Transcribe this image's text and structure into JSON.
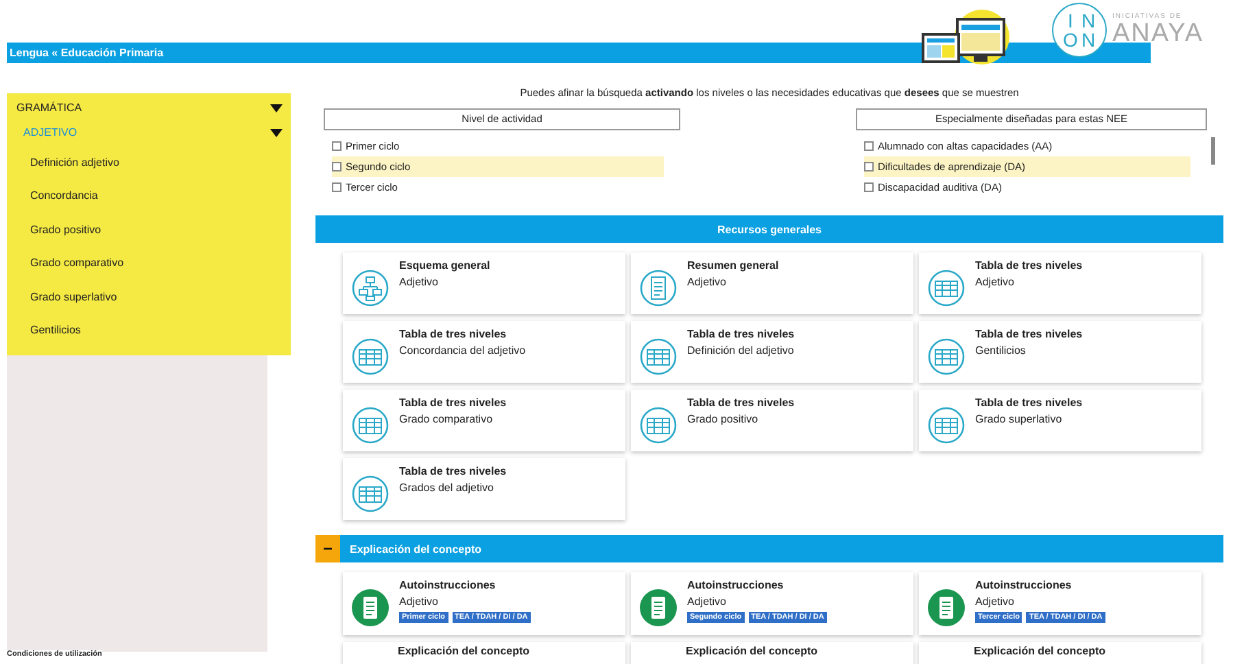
{
  "header": {
    "breadcrumb": "Lengua « Educación Primaria",
    "logo": {
      "tagline": "INICIATIVAS DE",
      "brand": "ANAYA",
      "monogram": [
        "I",
        "N",
        "O",
        "N"
      ]
    }
  },
  "sidebar": {
    "items": [
      {
        "label": "GRAMÁTICA",
        "expanded": true,
        "children": [
          {
            "label": "ADJETIVO",
            "expanded": true,
            "children": [
              {
                "label": "Definición adjetivo"
              },
              {
                "label": "Concordancia"
              },
              {
                "label": "Grado positivo"
              },
              {
                "label": "Grado comparativo"
              },
              {
                "label": "Grado superlativo"
              },
              {
                "label": "Gentilicios"
              }
            ]
          }
        ]
      }
    ]
  },
  "intro": "Puedes afinar la búsqueda **activando** los niveles o las necesidades educativas que **desees** que se muestren",
  "filters": [
    {
      "title": "Nivel de actividad",
      "scrollable": false,
      "options": [
        {
          "label": "Primer ciclo",
          "checked": false,
          "highlighted": false
        },
        {
          "label": "Segundo ciclo",
          "checked": false,
          "highlighted": true
        },
        {
          "label": "Tercer ciclo",
          "checked": false,
          "highlighted": false
        }
      ]
    },
    {
      "title": "Especialmente diseñadas para estas NEE",
      "scrollable": true,
      "options": [
        {
          "label": "Alumnado con altas capacidades (AA)",
          "checked": false,
          "highlighted": false
        },
        {
          "label": "Dificultades de aprendizaje (DA)",
          "checked": false,
          "highlighted": true
        },
        {
          "label": "Discapacidad auditiva (DA)",
          "checked": false,
          "highlighted": false
        }
      ]
    }
  ],
  "sections": [
    {
      "title": "Recursos generales",
      "cards": [
        {
          "kind": "scheme",
          "title": "Esquema general",
          "subtitle": "Adjetivo"
        },
        {
          "kind": "summary",
          "title": "Resumen general",
          "subtitle": "Adjetivo"
        },
        {
          "kind": "table",
          "title": "Tabla de tres niveles",
          "subtitle": "Adjetivo"
        },
        {
          "kind": "table",
          "title": "Tabla de tres niveles",
          "subtitle": "Concordancia del adjetivo"
        },
        {
          "kind": "table",
          "title": "Tabla de tres niveles",
          "subtitle": "Definición del adjetivo"
        },
        {
          "kind": "table",
          "title": "Tabla de tres niveles",
          "subtitle": "Gentilicios"
        },
        {
          "kind": "table",
          "title": "Tabla de tres niveles",
          "subtitle": "Grado comparativo"
        },
        {
          "kind": "table",
          "title": "Tabla de tres niveles",
          "subtitle": "Grado positivo"
        },
        {
          "kind": "table",
          "title": "Tabla de tres niveles",
          "subtitle": "Grado superlativo"
        },
        {
          "kind": "table",
          "title": "Tabla de tres niveles",
          "subtitle": "Grados del adjetivo"
        }
      ]
    },
    {
      "title": "Explicación del concepto",
      "collapse_toggle": "−",
      "cards": [
        {
          "kind": "guide",
          "title": "Autoinstrucciones",
          "subtitle": "Adjetivo",
          "tags": [
            "Primer ciclo",
            "TEA / TDAH / DI / DA"
          ]
        },
        {
          "kind": "guide",
          "title": "Autoinstrucciones",
          "subtitle": "Adjetivo",
          "tags": [
            "Segundo ciclo",
            "TEA / TDAH / DI / DA"
          ]
        },
        {
          "kind": "guide",
          "title": "Autoinstrucciones",
          "subtitle": "Adjetivo",
          "tags": [
            "Tercer ciclo",
            "TEA / TDAH / DI / DA"
          ]
        },
        {
          "kind": "partial",
          "title": "Explicación del concepto"
        },
        {
          "kind": "partial",
          "title": "Explicación del concepto"
        },
        {
          "kind": "partial",
          "title": "Explicación del concepto"
        }
      ]
    }
  ],
  "footer": {
    "link": "Condiciones de utilización"
  }
}
